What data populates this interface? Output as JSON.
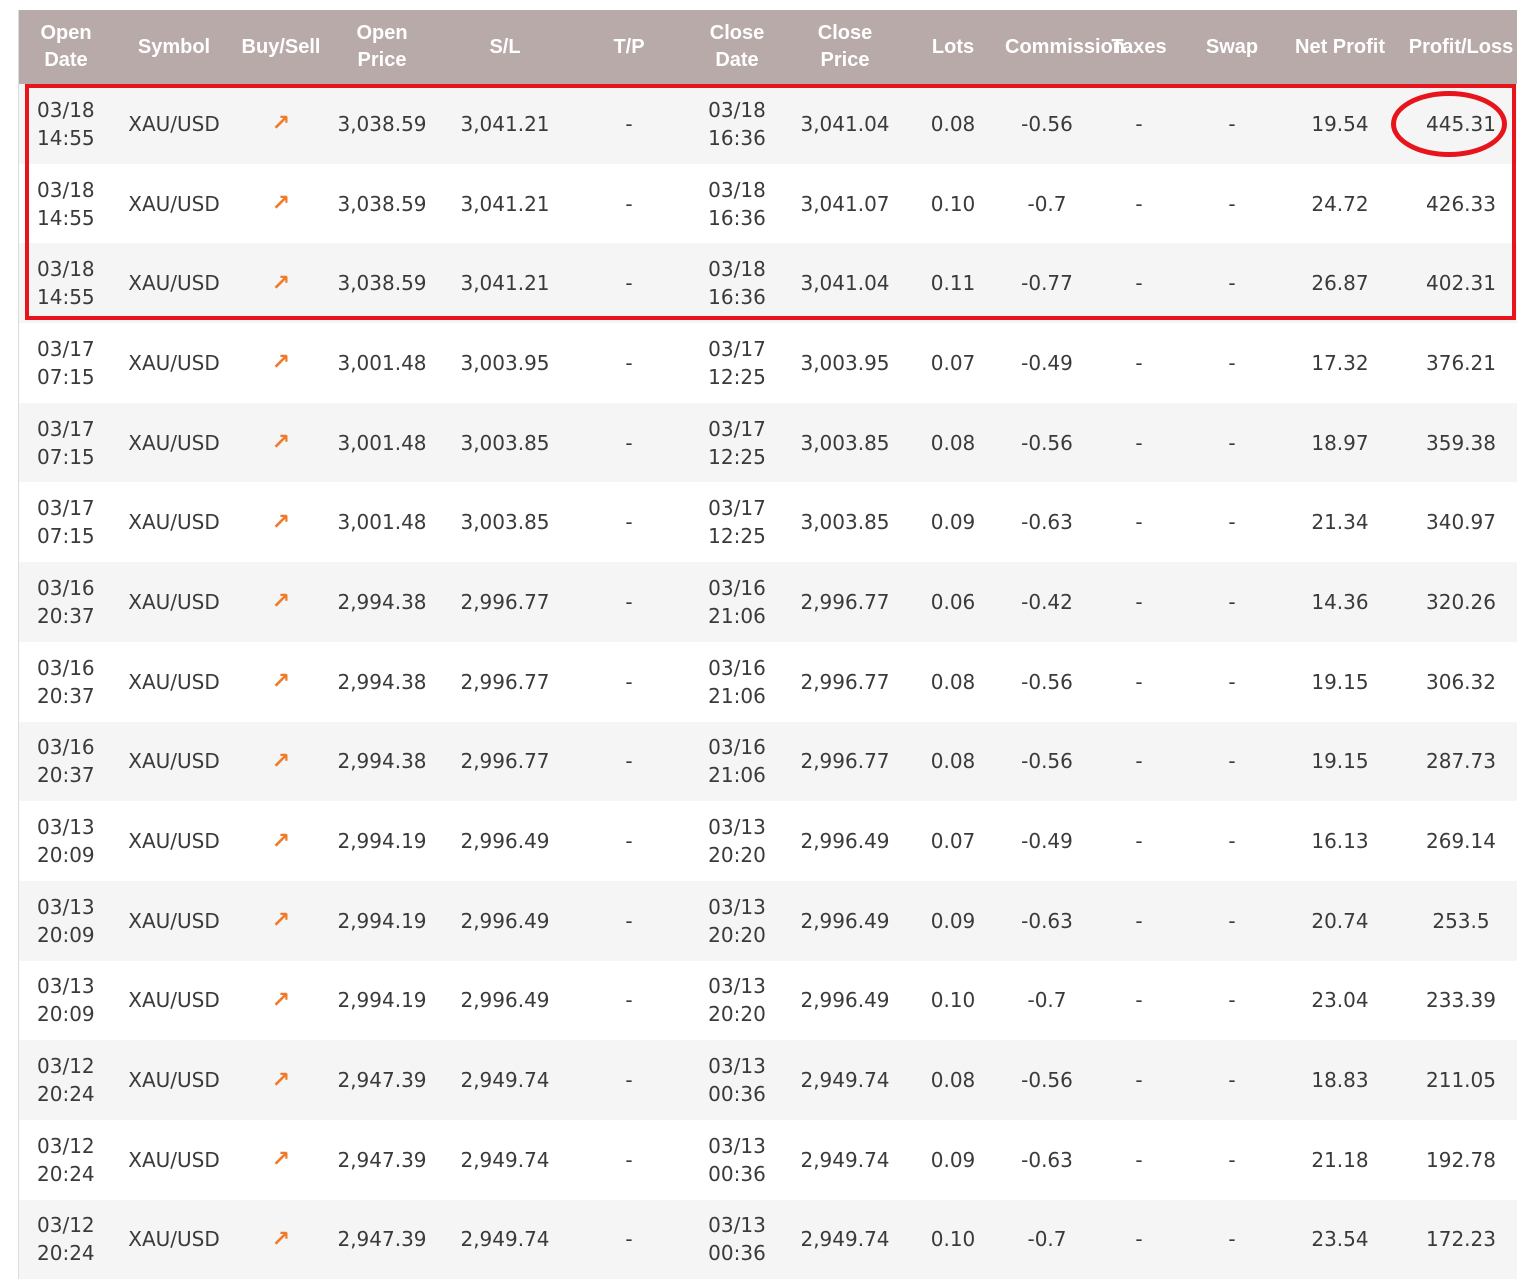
{
  "columns": [
    {
      "key": "open_date",
      "label": "Open\nDate"
    },
    {
      "key": "symbol",
      "label": "Symbol"
    },
    {
      "key": "side",
      "label": "Buy/Sell"
    },
    {
      "key": "open_price",
      "label": "Open\nPrice"
    },
    {
      "key": "sl",
      "label": "S/L"
    },
    {
      "key": "tp",
      "label": "T/P"
    },
    {
      "key": "close_date",
      "label": "Close\nDate"
    },
    {
      "key": "close_price",
      "label": "Close\nPrice"
    },
    {
      "key": "lots",
      "label": "Lots"
    },
    {
      "key": "commission",
      "label": "Commission"
    },
    {
      "key": "taxes",
      "label": "Taxes"
    },
    {
      "key": "swap",
      "label": "Swap"
    },
    {
      "key": "net_profit",
      "label": "Net Profit"
    },
    {
      "key": "profit_loss",
      "label": "Profit/Loss"
    }
  ],
  "side_icon": "arrow-up-right-icon",
  "colors": {
    "header_bg": "#b8aaa8",
    "row_alt_bg": "#f5f5f5",
    "buy_arrow": "#f07a2a",
    "annotation_red": "#e8141b"
  },
  "rows": [
    {
      "open_date": "03/18",
      "open_time": "14:55",
      "symbol": "XAU/USD",
      "side": "↗",
      "open_price": "3,038.59",
      "sl": "3,041.21",
      "tp": "-",
      "close_date": "03/18",
      "close_time": "16:36",
      "close_price": "3,041.04",
      "lots": "0.08",
      "commission": "-0.56",
      "taxes": "-",
      "swap": "-",
      "net_profit": "19.54",
      "profit_loss": "445.31"
    },
    {
      "open_date": "03/18",
      "open_time": "14:55",
      "symbol": "XAU/USD",
      "side": "↗",
      "open_price": "3,038.59",
      "sl": "3,041.21",
      "tp": "-",
      "close_date": "03/18",
      "close_time": "16:36",
      "close_price": "3,041.07",
      "lots": "0.10",
      "commission": "-0.7",
      "taxes": "-",
      "swap": "-",
      "net_profit": "24.72",
      "profit_loss": "426.33"
    },
    {
      "open_date": "03/18",
      "open_time": "14:55",
      "symbol": "XAU/USD",
      "side": "↗",
      "open_price": "3,038.59",
      "sl": "3,041.21",
      "tp": "-",
      "close_date": "03/18",
      "close_time": "16:36",
      "close_price": "3,041.04",
      "lots": "0.11",
      "commission": "-0.77",
      "taxes": "-",
      "swap": "-",
      "net_profit": "26.87",
      "profit_loss": "402.31"
    },
    {
      "open_date": "03/17",
      "open_time": "07:15",
      "symbol": "XAU/USD",
      "side": "↗",
      "open_price": "3,001.48",
      "sl": "3,003.95",
      "tp": "-",
      "close_date": "03/17",
      "close_time": "12:25",
      "close_price": "3,003.95",
      "lots": "0.07",
      "commission": "-0.49",
      "taxes": "-",
      "swap": "-",
      "net_profit": "17.32",
      "profit_loss": "376.21"
    },
    {
      "open_date": "03/17",
      "open_time": "07:15",
      "symbol": "XAU/USD",
      "side": "↗",
      "open_price": "3,001.48",
      "sl": "3,003.85",
      "tp": "-",
      "close_date": "03/17",
      "close_time": "12:25",
      "close_price": "3,003.85",
      "lots": "0.08",
      "commission": "-0.56",
      "taxes": "-",
      "swap": "-",
      "net_profit": "18.97",
      "profit_loss": "359.38"
    },
    {
      "open_date": "03/17",
      "open_time": "07:15",
      "symbol": "XAU/USD",
      "side": "↗",
      "open_price": "3,001.48",
      "sl": "3,003.85",
      "tp": "-",
      "close_date": "03/17",
      "close_time": "12:25",
      "close_price": "3,003.85",
      "lots": "0.09",
      "commission": "-0.63",
      "taxes": "-",
      "swap": "-",
      "net_profit": "21.34",
      "profit_loss": "340.97"
    },
    {
      "open_date": "03/16",
      "open_time": "20:37",
      "symbol": "XAU/USD",
      "side": "↗",
      "open_price": "2,994.38",
      "sl": "2,996.77",
      "tp": "-",
      "close_date": "03/16",
      "close_time": "21:06",
      "close_price": "2,996.77",
      "lots": "0.06",
      "commission": "-0.42",
      "taxes": "-",
      "swap": "-",
      "net_profit": "14.36",
      "profit_loss": "320.26"
    },
    {
      "open_date": "03/16",
      "open_time": "20:37",
      "symbol": "XAU/USD",
      "side": "↗",
      "open_price": "2,994.38",
      "sl": "2,996.77",
      "tp": "-",
      "close_date": "03/16",
      "close_time": "21:06",
      "close_price": "2,996.77",
      "lots": "0.08",
      "commission": "-0.56",
      "taxes": "-",
      "swap": "-",
      "net_profit": "19.15",
      "profit_loss": "306.32"
    },
    {
      "open_date": "03/16",
      "open_time": "20:37",
      "symbol": "XAU/USD",
      "side": "↗",
      "open_price": "2,994.38",
      "sl": "2,996.77",
      "tp": "-",
      "close_date": "03/16",
      "close_time": "21:06",
      "close_price": "2,996.77",
      "lots": "0.08",
      "commission": "-0.56",
      "taxes": "-",
      "swap": "-",
      "net_profit": "19.15",
      "profit_loss": "287.73"
    },
    {
      "open_date": "03/13",
      "open_time": "20:09",
      "symbol": "XAU/USD",
      "side": "↗",
      "open_price": "2,994.19",
      "sl": "2,996.49",
      "tp": "-",
      "close_date": "03/13",
      "close_time": "20:20",
      "close_price": "2,996.49",
      "lots": "0.07",
      "commission": "-0.49",
      "taxes": "-",
      "swap": "-",
      "net_profit": "16.13",
      "profit_loss": "269.14"
    },
    {
      "open_date": "03/13",
      "open_time": "20:09",
      "symbol": "XAU/USD",
      "side": "↗",
      "open_price": "2,994.19",
      "sl": "2,996.49",
      "tp": "-",
      "close_date": "03/13",
      "close_time": "20:20",
      "close_price": "2,996.49",
      "lots": "0.09",
      "commission": "-0.63",
      "taxes": "-",
      "swap": "-",
      "net_profit": "20.74",
      "profit_loss": "253.5"
    },
    {
      "open_date": "03/13",
      "open_time": "20:09",
      "symbol": "XAU/USD",
      "side": "↗",
      "open_price": "2,994.19",
      "sl": "2,996.49",
      "tp": "-",
      "close_date": "03/13",
      "close_time": "20:20",
      "close_price": "2,996.49",
      "lots": "0.10",
      "commission": "-0.7",
      "taxes": "-",
      "swap": "-",
      "net_profit": "23.04",
      "profit_loss": "233.39"
    },
    {
      "open_date": "03/12",
      "open_time": "20:24",
      "symbol": "XAU/USD",
      "side": "↗",
      "open_price": "2,947.39",
      "sl": "2,949.74",
      "tp": "-",
      "close_date": "03/13",
      "close_time": "00:36",
      "close_price": "2,949.74",
      "lots": "0.08",
      "commission": "-0.56",
      "taxes": "-",
      "swap": "-",
      "net_profit": "18.83",
      "profit_loss": "211.05"
    },
    {
      "open_date": "03/12",
      "open_time": "20:24",
      "symbol": "XAU/USD",
      "side": "↗",
      "open_price": "2,947.39",
      "sl": "2,949.74",
      "tp": "-",
      "close_date": "03/13",
      "close_time": "00:36",
      "close_price": "2,949.74",
      "lots": "0.09",
      "commission": "-0.63",
      "taxes": "-",
      "swap": "-",
      "net_profit": "21.18",
      "profit_loss": "192.78"
    },
    {
      "open_date": "03/12",
      "open_time": "20:24",
      "symbol": "XAU/USD",
      "side": "↗",
      "open_price": "2,947.39",
      "sl": "2,949.74",
      "tp": "-",
      "close_date": "03/13",
      "close_time": "00:36",
      "close_price": "2,949.74",
      "lots": "0.10",
      "commission": "-0.7",
      "taxes": "-",
      "swap": "-",
      "net_profit": "23.54",
      "profit_loss": "172.23"
    }
  ]
}
